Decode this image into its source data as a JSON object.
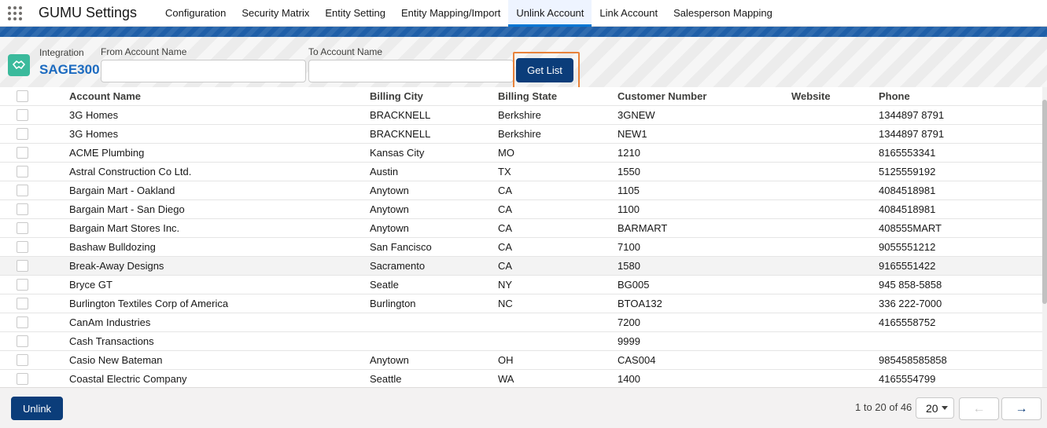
{
  "app": {
    "name": "GUMU Settings"
  },
  "tabs": [
    {
      "label": "Configuration"
    },
    {
      "label": "Security Matrix"
    },
    {
      "label": "Entity Setting"
    },
    {
      "label": "Entity Mapping/Import"
    },
    {
      "label": "Unlink Account",
      "active": true
    },
    {
      "label": "Link Account"
    },
    {
      "label": "Salesperson Mapping"
    }
  ],
  "integration": {
    "label": "Integration",
    "value": "SAGE300"
  },
  "filters": {
    "from": {
      "label": "From Account Name",
      "value": "",
      "placeholder": ""
    },
    "to": {
      "label": "To Account Name",
      "value": "",
      "placeholder": ""
    },
    "get_list_label": "Get List"
  },
  "table": {
    "columns": [
      "Account Name",
      "Billing City",
      "Billing State",
      "Customer Number",
      "Website",
      "Phone"
    ],
    "rows": [
      {
        "name": "3G Homes",
        "city": "BRACKNELL",
        "state": "Berkshire",
        "number": "3GNEW",
        "website": "",
        "phone": "1344897 8791"
      },
      {
        "name": "3G Homes",
        "city": "BRACKNELL",
        "state": "Berkshire",
        "number": "NEW1",
        "website": "",
        "phone": "1344897 8791"
      },
      {
        "name": "ACME Plumbing",
        "city": "Kansas City",
        "state": "MO",
        "number": "1210",
        "website": "",
        "phone": "8165553341"
      },
      {
        "name": "Astral Construction Co Ltd.",
        "city": "Austin",
        "state": "TX",
        "number": "1550",
        "website": "",
        "phone": "5125559192"
      },
      {
        "name": "Bargain Mart - Oakland",
        "city": "Anytown",
        "state": "CA",
        "number": "1105",
        "website": "",
        "phone": "4084518981"
      },
      {
        "name": "Bargain Mart - San Diego",
        "city": "Anytown",
        "state": "CA",
        "number": "1100",
        "website": "",
        "phone": "4084518981"
      },
      {
        "name": "Bargain Mart Stores Inc.",
        "city": "Anytown",
        "state": "CA",
        "number": "BARMART",
        "website": "",
        "phone": "408555MART"
      },
      {
        "name": "Bashaw Bulldozing",
        "city": "San Fancisco",
        "state": "CA",
        "number": "7100",
        "website": "",
        "phone": "9055551212"
      },
      {
        "name": "Break-Away Designs",
        "city": "Sacramento",
        "state": "CA",
        "number": "1580",
        "website": "",
        "phone": "9165551422"
      },
      {
        "name": "Bryce GT",
        "city": "Seatle",
        "state": "NY",
        "number": "BG005",
        "website": "",
        "phone": "945 858-5858"
      },
      {
        "name": "Burlington Textiles Corp of America",
        "city": "Burlington",
        "state": "NC",
        "number": "BTOA132",
        "website": "",
        "phone": "336 222-7000"
      },
      {
        "name": "CanAm Industries",
        "city": "",
        "state": "",
        "number": "7200",
        "website": "",
        "phone": "4165558752"
      },
      {
        "name": "Cash Transactions",
        "city": "",
        "state": "",
        "number": "9999",
        "website": "",
        "phone": ""
      },
      {
        "name": "Casio New Bateman",
        "city": "Anytown",
        "state": "OH",
        "number": "CAS004",
        "website": "",
        "phone": "985458585858"
      },
      {
        "name": "Coastal Electric Company",
        "city": "Seattle",
        "state": "WA",
        "number": "1400",
        "website": "",
        "phone": "4165554799"
      }
    ]
  },
  "footer": {
    "unlink_label": "Unlink",
    "page_info": "1 to 20 of 46",
    "page_size": "20",
    "prev_icon": "arrow-left-icon",
    "next_icon": "arrow-right-icon"
  },
  "colors": {
    "brand_blue": "#0b3d7a",
    "accent": "#0176d3",
    "highlight_ring": "#e8823a",
    "integration_icon": "#3bba9c"
  }
}
